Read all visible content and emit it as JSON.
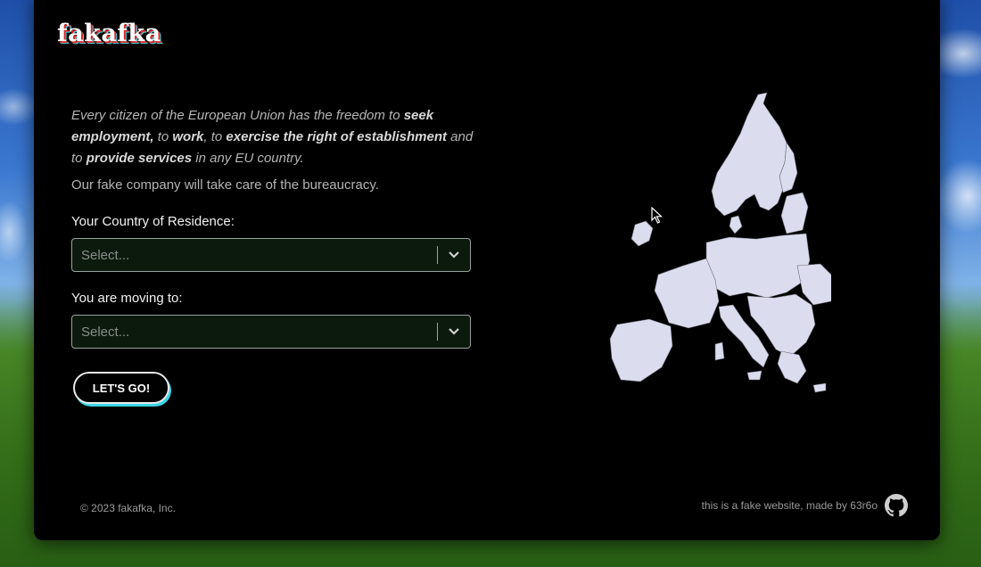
{
  "brand": {
    "logo": "fakafka"
  },
  "intro": {
    "t1": "Every citizen of the European Union has the freedom to ",
    "b1": "seek employment,",
    "t2": " to ",
    "b2": "work",
    "t3": ", to ",
    "b3": "exercise the right of establishment",
    "t4": " and to ",
    "b4": "provide services",
    "t5": " in any EU country.",
    "sub": "Our fake company will take care of the bureaucracy."
  },
  "form": {
    "residence_label": "Your Country of Residence:",
    "residence_placeholder": "Select...",
    "moving_label": "You are moving to:",
    "moving_placeholder": "Select...",
    "submit_label": "LET'S GO!"
  },
  "footer": {
    "copyright": "© 2023 fakafka, Inc.",
    "credit": "this is a fake website, made by 63r6o",
    "github_icon": "github-icon"
  },
  "colors": {
    "background": "#000000",
    "accent_cyan": "#3bd6e6",
    "accent_red": "#d92b2b",
    "map_fill": "#dcdcef"
  }
}
